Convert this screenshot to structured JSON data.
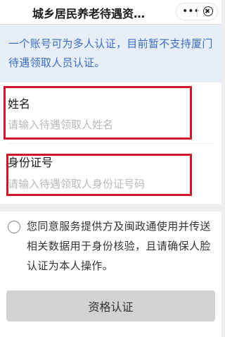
{
  "topbar": {
    "title": "城乡居民养老待遇资…",
    "more_icon": "more-dots-icon",
    "close_icon": "close-circle-icon"
  },
  "notice": {
    "text": "一个账号可为多人认证，目前暂不支持厦门待遇领取人员认证。"
  },
  "form": {
    "name_label": "姓名",
    "name_placeholder": "请输入待遇领取人姓名",
    "id_label": "身份证号",
    "id_placeholder": "请输入待遇领取人身份证号码"
  },
  "agreement": {
    "text": "您同意服务提供方及闽政通使用并传送相关数据用于身份核验，且请确保人脸认证为本人操作。"
  },
  "submit": {
    "label": "资格认证"
  },
  "colors": {
    "notice_text": "#3a6fc4",
    "notice_bg": "#e7eef8",
    "highlight": "#d0142b",
    "button_bg": "#d2d2d2"
  }
}
